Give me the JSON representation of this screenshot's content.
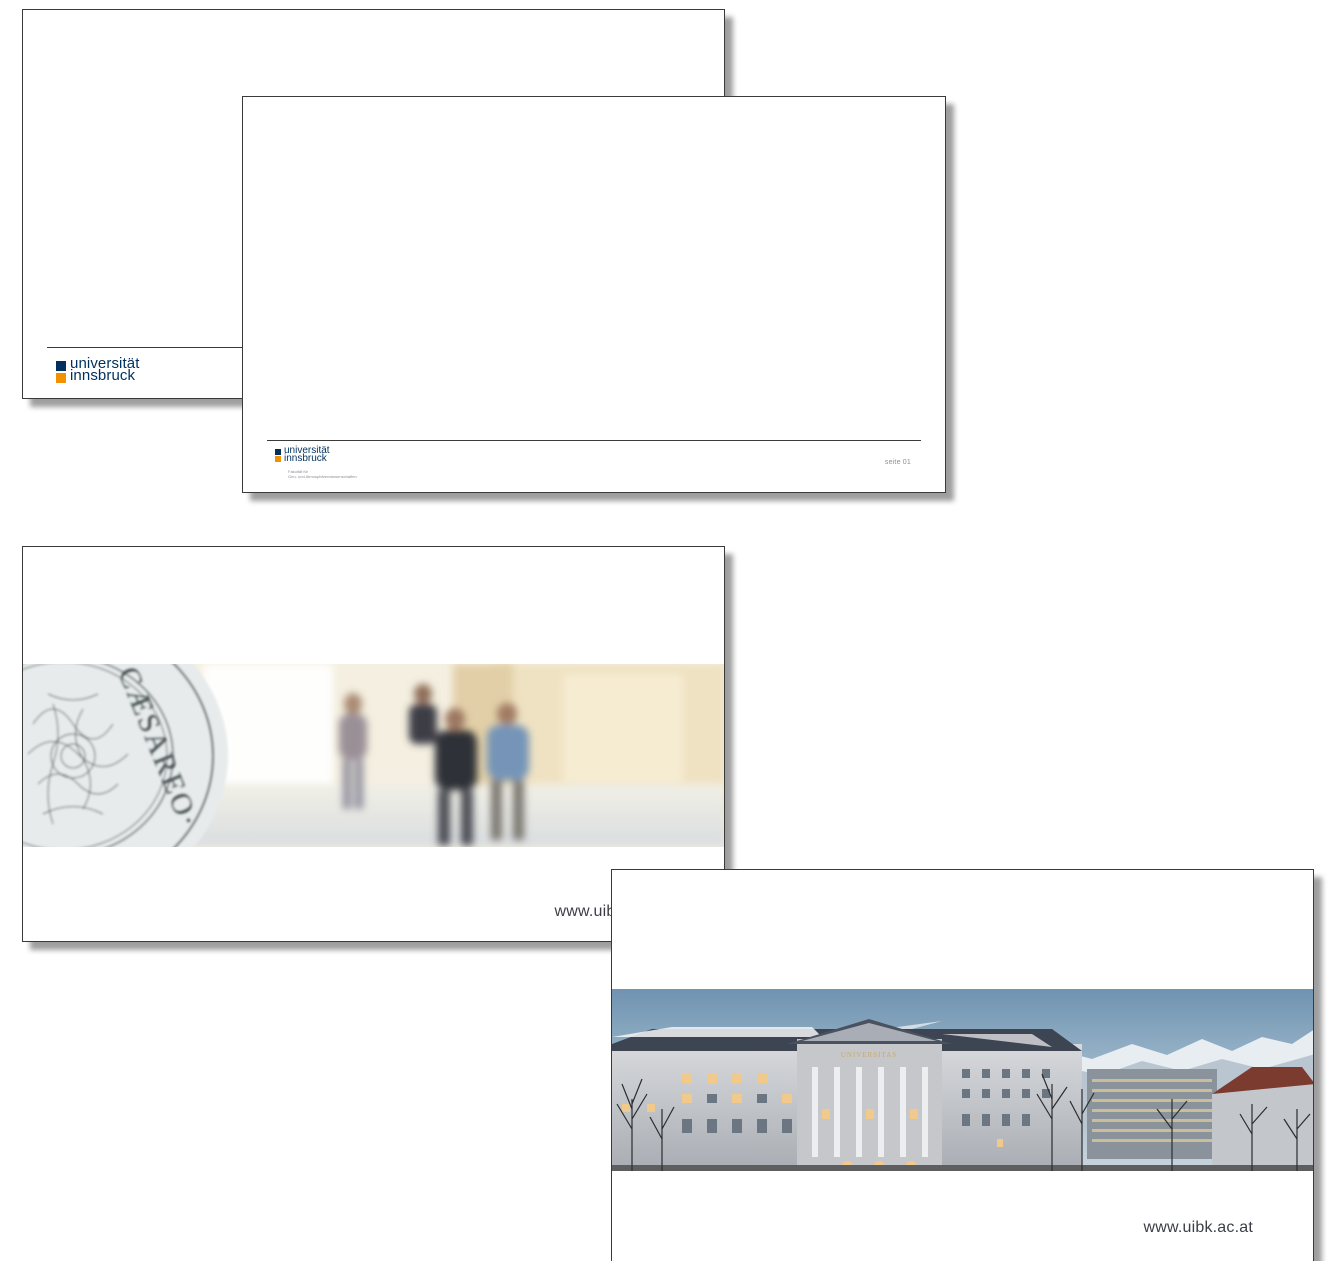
{
  "slides": {
    "title_slide_back": {
      "logo": {
        "line1": "universität",
        "line2": "innsbruck"
      }
    },
    "content_slide": {
      "logo": {
        "line1": "universität",
        "line2": "innsbruck"
      },
      "faculty_line1": "Fakultät für",
      "faculty_line2": "Geo- und Atmosphärenwissenschaften",
      "page_number": "seite 01"
    },
    "closing_slide_seal": {
      "seal_text": "CÆSAREO·",
      "url": "www.uibk.ac.at"
    },
    "closing_slide_building": {
      "building_inscription": "UNIVERSITAS",
      "url": "www.uibk.ac.at"
    }
  },
  "colors": {
    "brand_blue": "#00305e",
    "brand_orange": "#f39200",
    "slide_border": "#3a3a3a",
    "muted_text": "#8a8f98"
  }
}
